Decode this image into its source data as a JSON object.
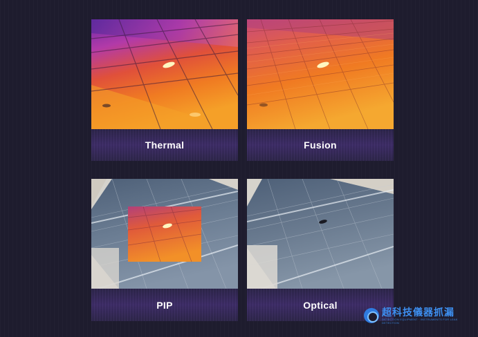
{
  "cards": [
    {
      "id": "thermal",
      "label": "Thermal",
      "view": "thermal-image"
    },
    {
      "id": "fusion",
      "label": "Fusion",
      "view": "fusion-image"
    },
    {
      "id": "pip",
      "label": "PIP",
      "view": "picture-in-picture-image"
    },
    {
      "id": "optical",
      "label": "Optical",
      "view": "optical-image"
    }
  ],
  "watermark": {
    "title": "超科技儀器抓漏",
    "subtitle": "DETECTION EQUIPMENT · INSTRUMENTS FOR LEAK DETECTION"
  },
  "colors": {
    "background": "#1e1c2e",
    "thermal_hot": "#f5a020",
    "thermal_cold": "#8a2bb0",
    "panel_blue": "#5e6f86",
    "brand": "#3d8ff0"
  }
}
